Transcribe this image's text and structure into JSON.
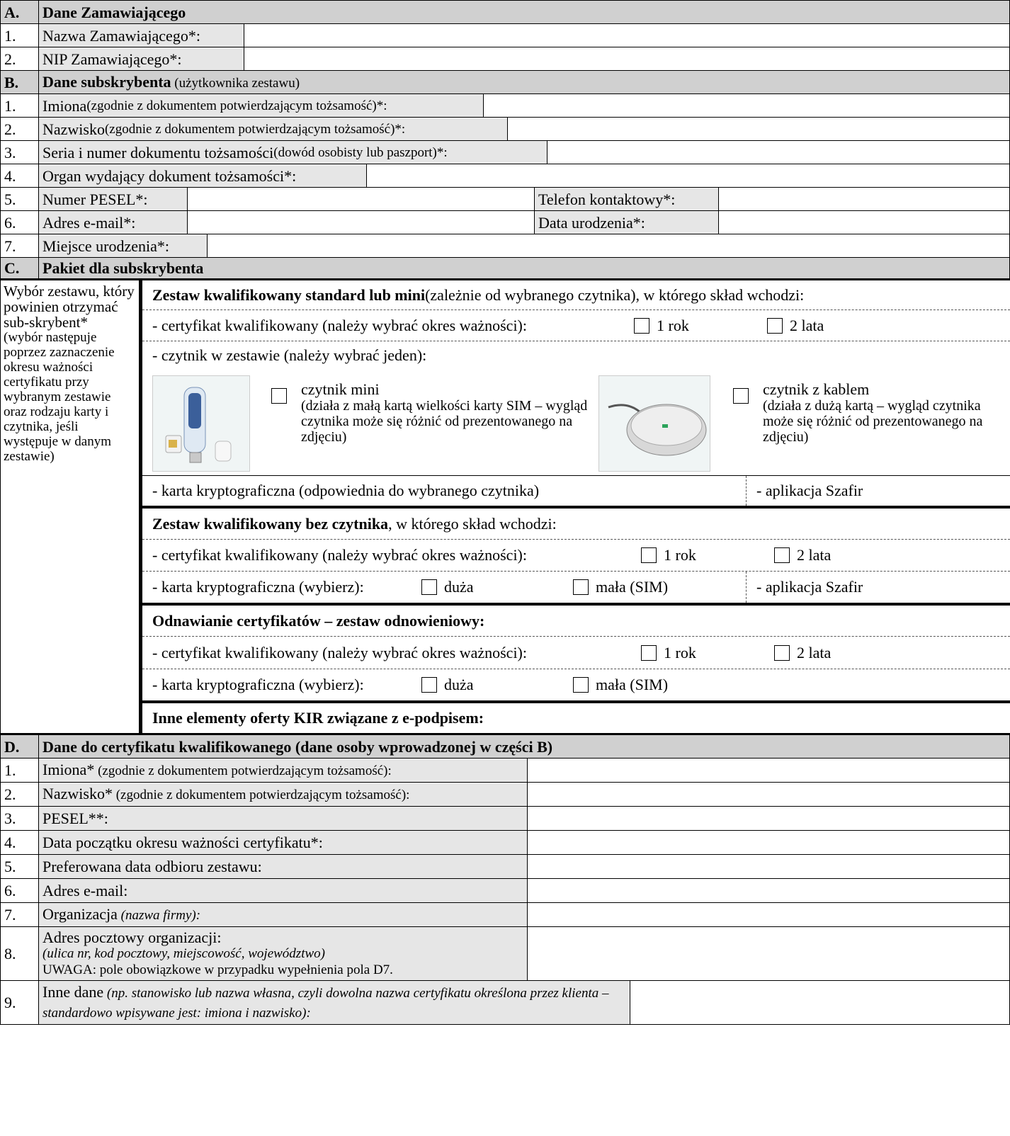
{
  "sectionA": {
    "letter": "A.",
    "title": "Dane Zamawiającego",
    "rows": [
      {
        "num": "1.",
        "label": "Nazwa Zamawiającego*:"
      },
      {
        "num": "2.",
        "label": "NIP Zamawiającego*:"
      }
    ]
  },
  "sectionB": {
    "letter": "B.",
    "title": "Dane subskrybenta",
    "title_note": " (użytkownika zestawu)",
    "rows": [
      {
        "num": "1.",
        "label": "Imiona",
        "note": " (zgodnie z dokumentem potwierdzającym tożsamość)*:"
      },
      {
        "num": "2.",
        "label": "Nazwisko",
        "note": " (zgodnie z dokumentem potwierdzającym tożsamość)*:"
      },
      {
        "num": "3.",
        "label": "Seria i numer dokumentu tożsamości",
        "note": " (dowód osobisty lub paszport)*:"
      },
      {
        "num": "4.",
        "label": "Organ wydający dokument tożsamości*:"
      },
      {
        "num": "5.",
        "label": "Numer PESEL*:",
        "label2": "Telefon kontaktowy*:"
      },
      {
        "num": "6.",
        "label": "Adres e-mail*:",
        "label2": "Data urodzenia*:"
      },
      {
        "num": "7.",
        "label": "Miejsce urodzenia*:"
      }
    ]
  },
  "sectionC": {
    "letter": "C.",
    "title": "Pakiet dla subskrybenta",
    "left_main": "Wybór zestawu, który powinien otrzymać sub-skrybent*",
    "left_note": "(wybór następuje poprzez zaznaczenie okresu ważności certyfikatu przy wybranym zestawie oraz rodzaju karty i czytnika, jeśli występuje w danym zestawie)",
    "set1_title": "Zestaw kwalifikowany standard lub mini",
    "set1_rest": " (zależnie od wybranego czytnika), w którego skład wchodzi:",
    "cert_line": "- certyfikat kwalifikowany (należy wybrać okres ważności):",
    "opt_1rok": "1 rok",
    "opt_2lata": "2 lata",
    "reader_line": "- czytnik w zestawie (należy wybrać jeden):",
    "reader_mini_title": "czytnik mini",
    "reader_mini_desc": "(działa z małą kartą wielkości karty SIM – wygląd czytnika może się różnić od prezentowanego na zdjęciu)",
    "reader_cable_title": "czytnik z kablem",
    "reader_cable_desc": "(działa z dużą kartą – wygląd czytnika może się różnić od prezentowanego na zdjęciu)",
    "card_line1": "- karta kryptograficzna (odpowiednia do wybranego czytnika)",
    "app_line": "- aplikacja Szafir",
    "set2_title": "Zestaw kwalifikowany bez czytnika",
    "set2_rest": ", w którego skład wchodzi:",
    "card_choose": "- karta kryptograficzna (wybierz):",
    "opt_duza": "duża",
    "opt_mala": "mała (SIM)",
    "set3_title": "Odnawianie certyfikatów – zestaw odnowieniowy:",
    "set4_title": "Inne elementy oferty KIR związane z e-podpisem:"
  },
  "sectionD": {
    "letter": "D.",
    "title": "Dane do certyfikatu kwalifikowanego (dane osoby wprowadzonej w części B)",
    "rows": [
      {
        "num": "1.",
        "label": "Imiona*",
        "note": " (zgodnie z dokumentem potwierdzającym tożsamość):"
      },
      {
        "num": "2.",
        "label": "Nazwisko*",
        "note": " (zgodnie z dokumentem potwierdzającym tożsamość):"
      },
      {
        "num": "3.",
        "label": "PESEL**:"
      },
      {
        "num": "4.",
        "label": "Data początku okresu ważności certyfikatu*:"
      },
      {
        "num": "5.",
        "label": "Preferowana data odbioru zestawu:"
      },
      {
        "num": "6.",
        "label": "Adres e-mail:"
      },
      {
        "num": "7.",
        "label": "Organizacja",
        "note": " (nazwa firmy):"
      },
      {
        "num": "8.",
        "label": "Adres pocztowy organizacji:",
        "note": "(ulica nr, kod pocztowy, miejscowość, województwo)",
        "note2": "UWAGA: pole obowiązkowe w przypadku wypełnienia pola D7."
      },
      {
        "num": "9.",
        "label": "Inne dane",
        "note": " (np. stanowisko lub nazwa własna, czyli dowolna nazwa certyfikatu określona przez klienta – standardowo wpisywane jest: imiona i nazwisko):"
      }
    ]
  }
}
